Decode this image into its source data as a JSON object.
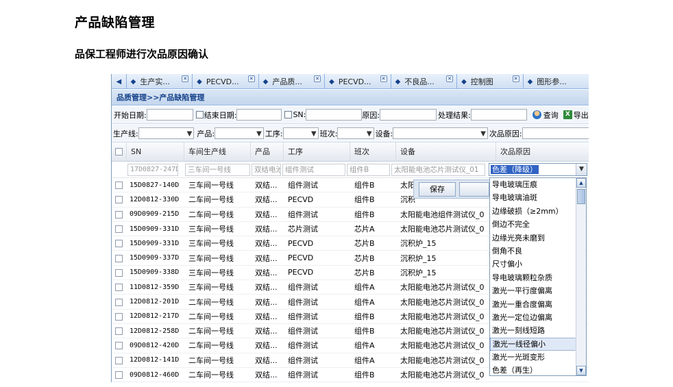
{
  "page": {
    "title": "产品缺陷管理",
    "subtitle": "品保工程师进行次品原因确认"
  },
  "tabs": [
    {
      "label": "生产实..."
    },
    {
      "label": "PECVD..."
    },
    {
      "label": "产品质..."
    },
    {
      "label": "PECVD..."
    },
    {
      "label": "不良品..."
    },
    {
      "label": "控制图"
    },
    {
      "label": "图形参..."
    }
  ],
  "breadcrumb": "品质管理>>产品缺陷管理",
  "filters": {
    "start_date": "开始日期:",
    "end_date": "结束日期:",
    "sn": "SN:",
    "reason": "原因:",
    "result": "处理结果:",
    "query": "查询",
    "export": "导出",
    "line": "生产线:",
    "product": "产品:",
    "process": "工序:",
    "shift": "班次:",
    "equipment": "设备:",
    "defect_reason": "次品原因:"
  },
  "grid": {
    "columns": [
      "SN",
      "车间生产线",
      "产品",
      "工序",
      "班次",
      "设备",
      "次品原因"
    ],
    "editor": {
      "sn": "17D0827-247D",
      "line": "三车间一号线",
      "product": "双结电池",
      "process": "组件测试",
      "shift": "组件B",
      "equipment": "太阳能电池芯片测试仪_01",
      "reason": "色差（降级）"
    },
    "rows": [
      [
        "15D0827-140D",
        "三车间一号线",
        "双结...",
        "组件测试",
        "组件B",
        "太阳"
      ],
      [
        "12D0812-330D",
        "二车间一号线",
        "双结...",
        "PECVD",
        "组件B",
        "沉积"
      ],
      [
        "09D0909-215D",
        "二车间一号线",
        "双结...",
        "组件测试",
        "组件B",
        "太阳能电池组件测试仪_0"
      ],
      [
        "15D0909-331D",
        "三车间一号线",
        "双结...",
        "芯片测试",
        "芯片A",
        "太阳能电池芯片测试仪_0"
      ],
      [
        "15D0909-331D",
        "三车间一号线",
        "双结...",
        "PECVD",
        "芯片B",
        "沉积炉_15"
      ],
      [
        "15D0909-337D",
        "三车间一号线",
        "双结...",
        "PECVD",
        "芯片B",
        "沉积炉_15"
      ],
      [
        "15D0909-338D",
        "三车间一号线",
        "双结...",
        "PECVD",
        "芯片B",
        "沉积炉_15"
      ],
      [
        "11D0812-359D",
        "三车间一号线",
        "双结...",
        "组件测试",
        "组件A",
        "太阳能电池芯片测试仪_0"
      ],
      [
        "12D0812-201D",
        "二车间一号线",
        "双结...",
        "组件测试",
        "组件A",
        "太阳能电池芯片测试仪_0"
      ],
      [
        "12D0812-217D",
        "二车间一号线",
        "双结...",
        "组件测试",
        "组件B",
        "太阳能电池芯片测试仪_0"
      ],
      [
        "12D0812-258D",
        "二车间一号线",
        "双结...",
        "组件测试",
        "组件B",
        "太阳能电池芯片测试仪_0"
      ],
      [
        "09D0812-420D",
        "二车间一号线",
        "双结...",
        "组件测试",
        "组件A",
        "太阳能电池芯片测试仪_0"
      ],
      [
        "12D0812-141D",
        "二车间一号线",
        "双结...",
        "组件测试",
        "组件A",
        "太阳能电池芯片测试仪_0"
      ],
      [
        "09D0812-460D",
        "二车间一号线",
        "双结...",
        "组件测试",
        "组件B",
        "太阳能电池芯片测试仪_0"
      ]
    ]
  },
  "row_editor": {
    "save": "保存",
    "cancel": ""
  },
  "reason_options": [
    "导电玻璃压痕",
    "导电玻璃油斑",
    "边缘破损（≥2mm）",
    "倒边不完全",
    "边缘光亮未磨到",
    "倒角不良",
    "尺寸偏小",
    "导电玻璃颗粒杂质",
    "激光一平行度偏离",
    "激光一重合度偏离",
    "激光一定位边偏离",
    "激光一刻线短路",
    "激光一线径偏小",
    "激光一光斑变形",
    "色差（再生）"
  ],
  "reason_highlighted": "激光一线径偏小"
}
